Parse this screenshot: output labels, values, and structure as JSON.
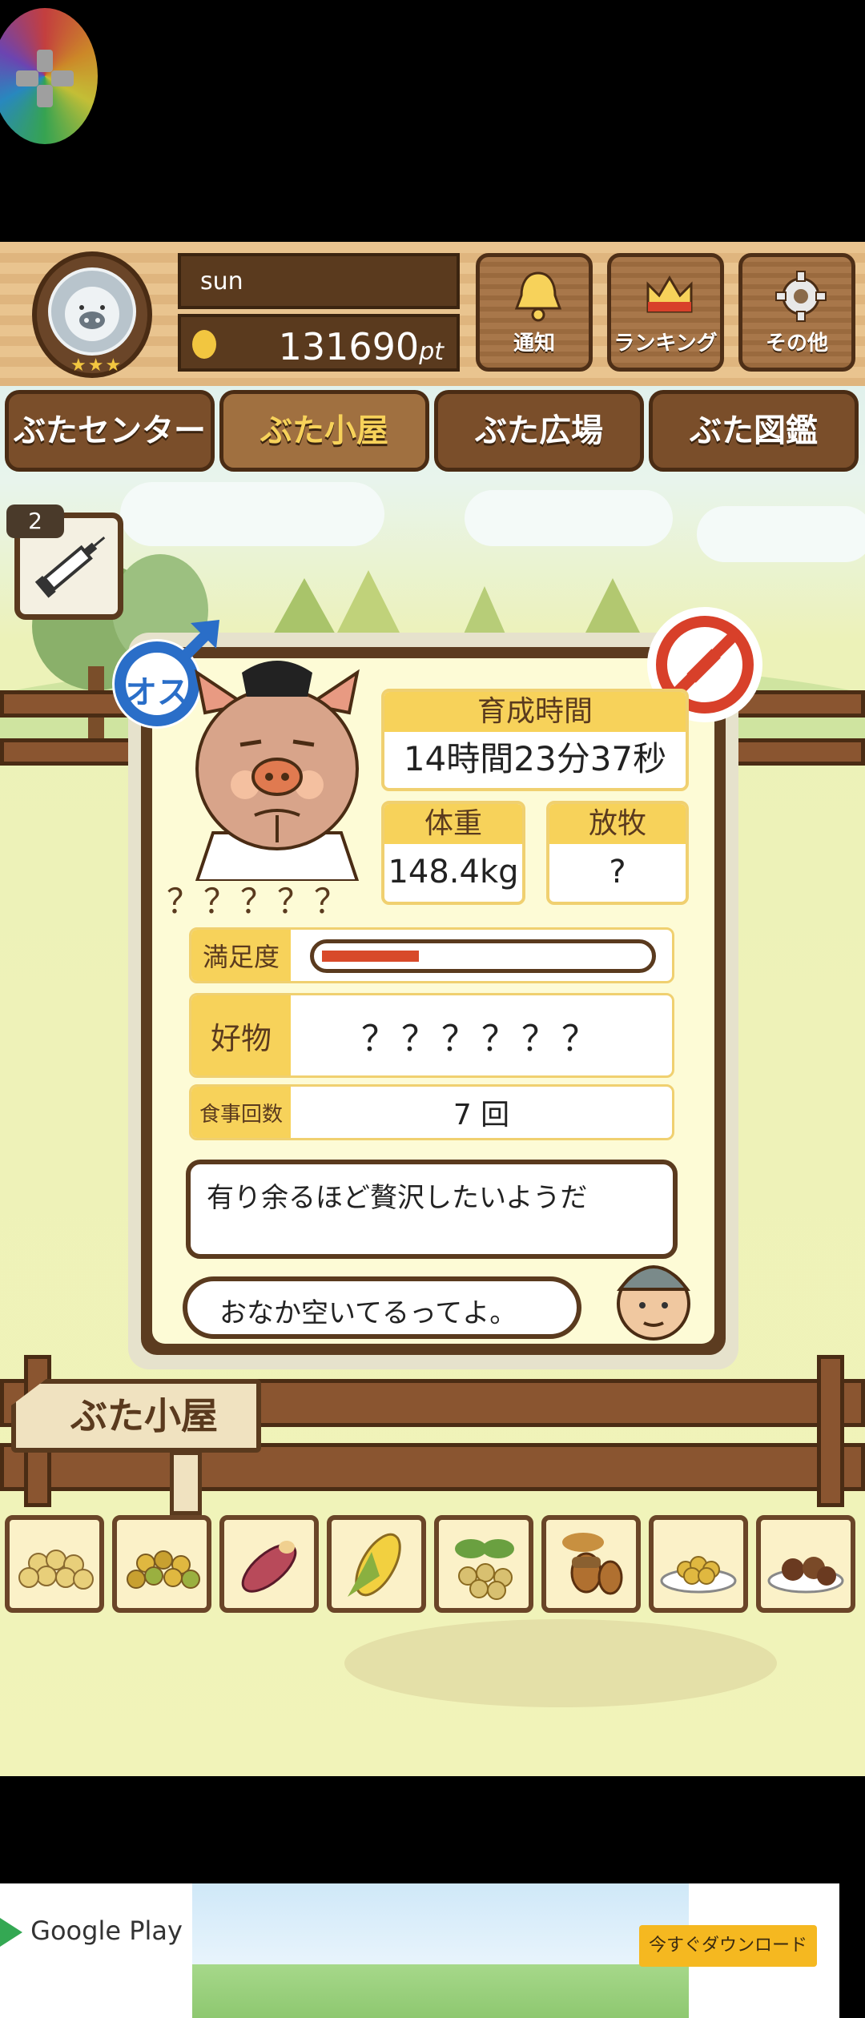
{
  "header": {
    "username": "sun",
    "points_value": "131690",
    "points_unit": "pt",
    "rank_stars": "★★★",
    "buttons": [
      {
        "label": "通知",
        "icon": "bell-icon"
      },
      {
        "label": "ランキング",
        "icon": "crown-icon"
      },
      {
        "label": "その他",
        "icon": "gear-icon"
      }
    ]
  },
  "tabs": [
    {
      "label": "ぶたセンター",
      "active": false
    },
    {
      "label": "ぶた小屋",
      "active": true
    },
    {
      "label": "ぶた広場",
      "active": false
    },
    {
      "label": "ぶた図鑑",
      "active": false
    }
  ],
  "item_slot": {
    "count": "2",
    "icon": "syringe-icon"
  },
  "pig_card": {
    "gender_label": "オス",
    "pig_name": "？？？？？",
    "raising_time_label": "育成時間",
    "raising_time_value": "14時間23分37秒",
    "weight_label": "体重",
    "weight_value": "148.4kg",
    "grazing_label": "放牧",
    "grazing_value": "?",
    "satisfaction_label": "満足度",
    "satisfaction_level": 0.3,
    "favorite_label": "好物",
    "favorite_value": "？？？？？？",
    "meal_count_label": "食事回数",
    "meal_count_value": "7 回",
    "pig_comment": "有り余るほど贅沢したいようだ",
    "farmer_comment": "おなか空いてるってよ。"
  },
  "sign": {
    "label": "ぶた小屋"
  },
  "food_items": [
    {
      "icon": "soybeans-icon"
    },
    {
      "icon": "mixed-grain-icon"
    },
    {
      "icon": "sweet-potato-icon"
    },
    {
      "icon": "corn-icon"
    },
    {
      "icon": "nuts-leaf-icon"
    },
    {
      "icon": "acorn-icon"
    },
    {
      "icon": "grain-plate-icon"
    },
    {
      "icon": "chestnut-plate-icon"
    }
  ],
  "ad": {
    "store_label": "Google Play",
    "cta_label": "今すぐダウンロード"
  },
  "colors": {
    "accent_yellow": "#f7d25a",
    "wood_dark": "#5a3a1e",
    "satisfaction_bar": "#d84a2a",
    "male_blue": "#2a6ec8",
    "forbidden_red": "#d8402a"
  }
}
